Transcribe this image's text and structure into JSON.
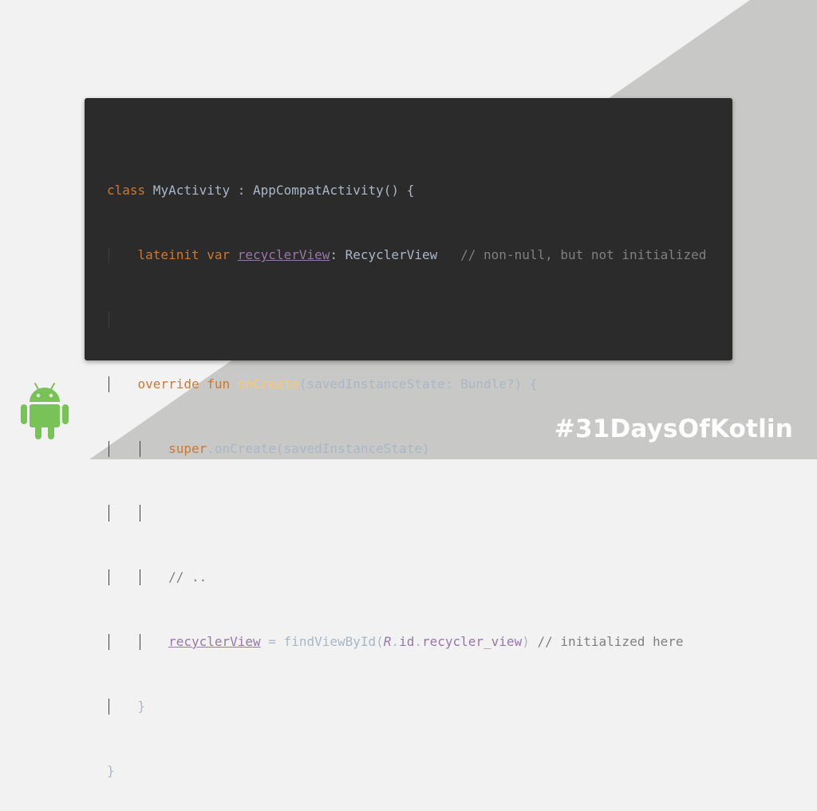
{
  "colors": {
    "background": "#f2f2f2",
    "diagonal": "#c8c8c6",
    "code_background": "#2b2b2b",
    "keyword": "#cc7832",
    "function": "#ffc66d",
    "property": "#9876aa",
    "comment": "#808080",
    "text": "#a9b7c6",
    "android_green": "#78c257"
  },
  "code": {
    "l1": {
      "kw": "class",
      "rest": " MyActivity : AppCompatActivity() {"
    },
    "l2": {
      "kw": "lateinit var",
      "prop": "recyclerView",
      "rest": ": RecyclerView   ",
      "comment": "// non-null, but not initialized"
    },
    "l4": {
      "kw": "override fun",
      "fn": "onCreate",
      "rest": "(savedInstanceState: Bundle?) {"
    },
    "l5": {
      "kw": "super",
      "rest": ".onCreate(savedInstanceState)"
    },
    "l7": {
      "comment": "// .."
    },
    "l8": {
      "prop": "recyclerView",
      "assign": " = findViewById(",
      "r": "R",
      "dot1": ".",
      "id": "id",
      "dot2": ".",
      "rv": "recycler_view",
      "close": ") ",
      "comment": "// initialized here"
    },
    "l9": {
      "brace": "}"
    },
    "l10": {
      "brace": "}"
    }
  },
  "hashtag": "#31DaysOfKotlin",
  "logo_icon": "android-robot-icon"
}
